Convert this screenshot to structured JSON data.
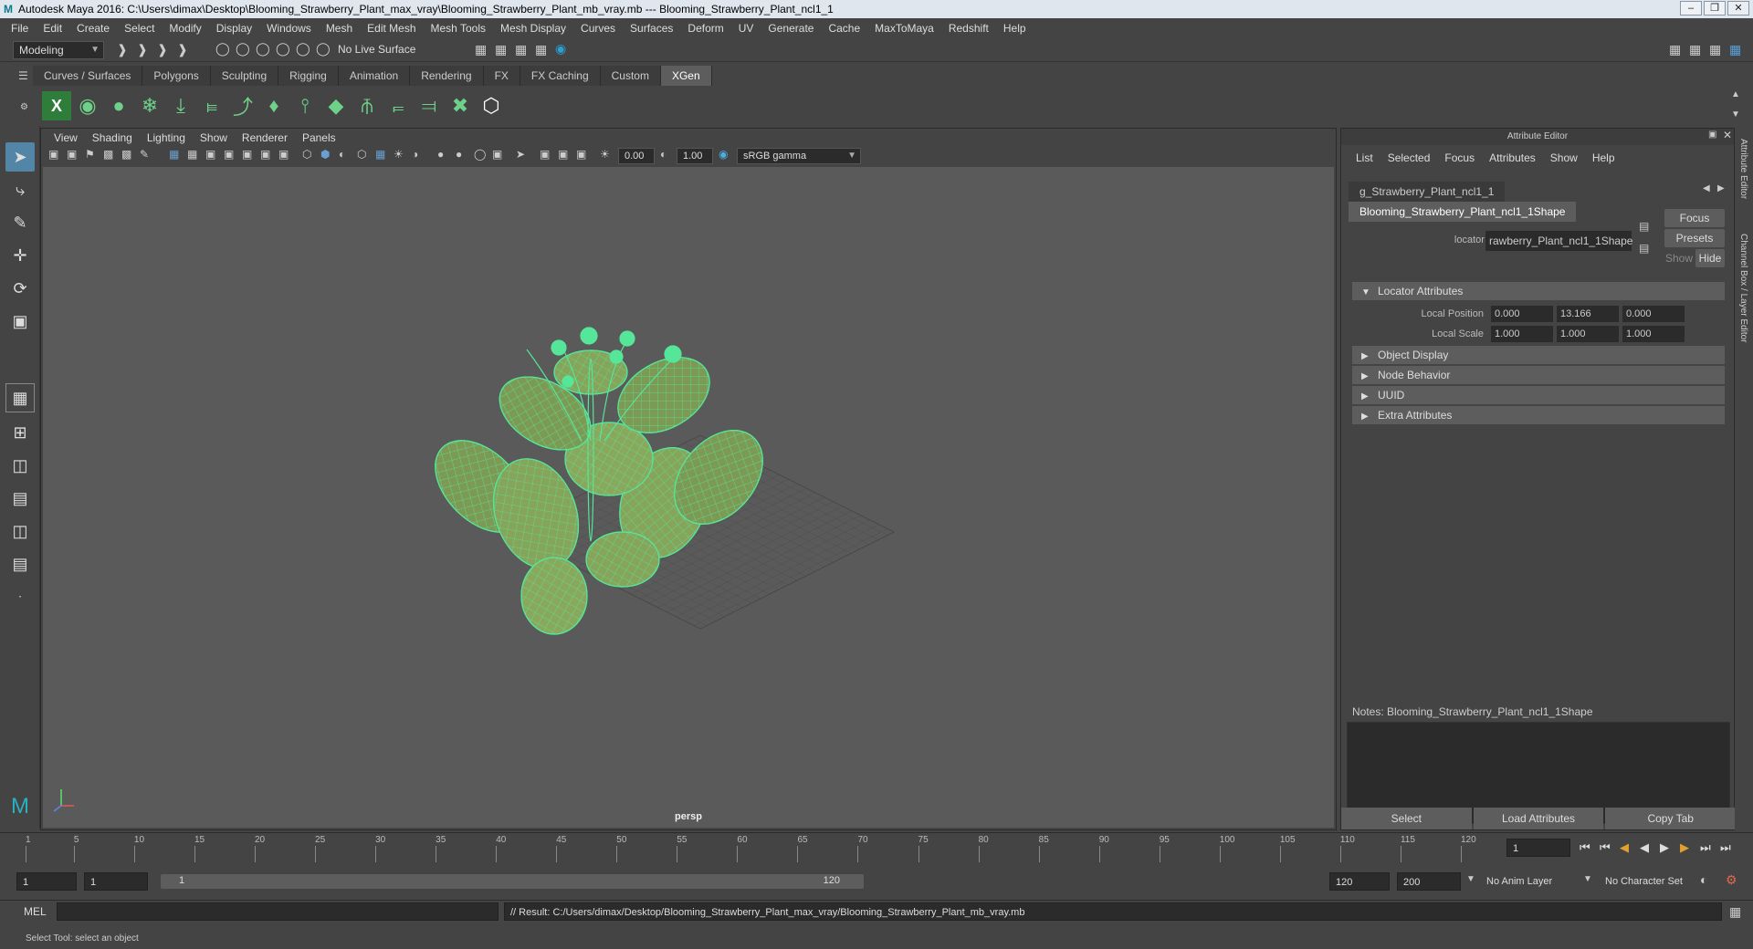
{
  "window": {
    "title": "Autodesk Maya 2016: C:\\Users\\dimax\\Desktop\\Blooming_Strawberry_Plant_max_vray\\Blooming_Strawberry_Plant_mb_vray.mb   ---   Blooming_Strawberry_Plant_ncl1_1"
  },
  "menubar": [
    "File",
    "Edit",
    "Create",
    "Select",
    "Modify",
    "Display",
    "Windows",
    "Mesh",
    "Edit Mesh",
    "Mesh Tools",
    "Mesh Display",
    "Curves",
    "Surfaces",
    "Deform",
    "UV",
    "Generate",
    "Cache",
    "MaxToMaya",
    "Redshift",
    "Help"
  ],
  "statusline": {
    "mode": "Modeling",
    "live_surface": "No Live Surface"
  },
  "shelf": {
    "tabs": [
      "Curves / Surfaces",
      "Polygons",
      "Sculpting",
      "Rigging",
      "Animation",
      "Rendering",
      "FX",
      "FX Caching",
      "Custom",
      "XGen"
    ],
    "active_tab": "XGen"
  },
  "viewport": {
    "menu": [
      "View",
      "Shading",
      "Lighting",
      "Show",
      "Renderer",
      "Panels"
    ],
    "exposure": "0.00",
    "gamma": "1.00",
    "color_space": "sRGB gamma",
    "camera_label": "persp"
  },
  "attribute_editor": {
    "title": "Attribute Editor",
    "menu": [
      "List",
      "Selected",
      "Focus",
      "Attributes",
      "Show",
      "Help"
    ],
    "tabs": [
      "g_Strawberry_Plant_ncl1_1",
      "Blooming_Strawberry_Plant_ncl1_1Shape"
    ],
    "active_tab": 1,
    "locator_label": "locator:",
    "locator_value": "rawberry_Plant_ncl1_1Shape",
    "focus_btn": "Focus",
    "presets_btn": "Presets",
    "show_btn": "Show",
    "hide_btn": "Hide",
    "sections": {
      "locator_attributes": "Locator Attributes",
      "object_display": "Object Display",
      "node_behavior": "Node Behavior",
      "uuid": "UUID",
      "extra_attributes": "Extra Attributes"
    },
    "local_position": {
      "label": "Local Position",
      "x": "0.000",
      "y": "13.166",
      "z": "0.000"
    },
    "local_scale": {
      "label": "Local Scale",
      "x": "1.000",
      "y": "1.000",
      "z": "1.000"
    },
    "notes_label": "Notes:  Blooming_Strawberry_Plant_ncl1_1Shape",
    "buttons": {
      "select": "Select",
      "load": "Load Attributes",
      "copy": "Copy Tab"
    },
    "side_tabs": [
      "Attribute Editor",
      "Channel Box / Layer Editor"
    ]
  },
  "timeline": {
    "ticks": [
      "1",
      "5",
      "10",
      "15",
      "20",
      "25",
      "30",
      "35",
      "40",
      "45",
      "50",
      "55",
      "60",
      "65",
      "70",
      "75",
      "80",
      "85",
      "90",
      "95",
      "100",
      "105",
      "110",
      "115",
      "120"
    ],
    "current_frame": "1"
  },
  "range": {
    "start": "1",
    "start2": "1",
    "slider_start": "1",
    "slider_end": "120",
    "end": "120",
    "end2": "200",
    "anim_layer": "No Anim Layer",
    "char_set": "No Character Set"
  },
  "mel": {
    "label": "MEL",
    "result": "// Result: C:/Users/dimax/Desktop/Blooming_Strawberry_Plant_max_vray/Blooming_Strawberry_Plant_mb_vray.mb"
  },
  "helpline": "Select Tool: select an object",
  "colors": {
    "wire": "#55e69a",
    "accent": "#5285a6"
  }
}
